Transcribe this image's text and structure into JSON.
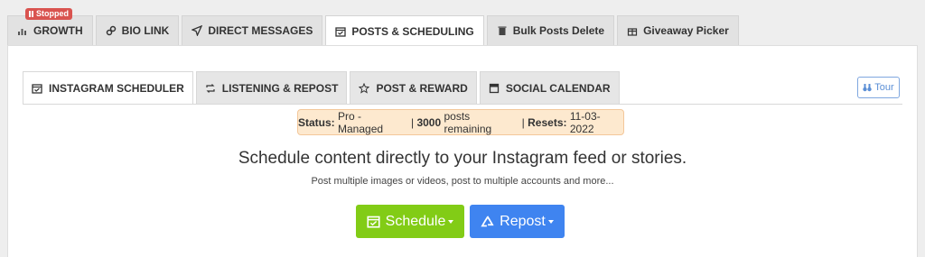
{
  "top_tabs": [
    {
      "label": "GROWTH",
      "icon": "bar-chart-icon",
      "badge": "Stopped"
    },
    {
      "label": "BIO LINK",
      "icon": "link-icon"
    },
    {
      "label": "DIRECT MESSAGES",
      "icon": "paper-plane-icon"
    },
    {
      "label": "POSTS & SCHEDULING",
      "icon": "calendar-check-icon",
      "active": true
    },
    {
      "label": "Bulk Posts Delete",
      "icon": "trash-icon"
    },
    {
      "label": "Giveaway Picker",
      "icon": "gift-icon"
    }
  ],
  "sub_tabs": [
    {
      "label": "INSTAGRAM SCHEDULER",
      "icon": "calendar-check-icon",
      "active": true
    },
    {
      "label": "LISTENING & REPOST",
      "icon": "retweet-icon"
    },
    {
      "label": "POST & REWARD",
      "icon": "star-icon"
    },
    {
      "label": "SOCIAL CALENDAR",
      "icon": "calendar-icon"
    }
  ],
  "tour_label": "Tour",
  "status": {
    "status_label": "Status:",
    "status_value": "Pro - Managed",
    "sep1": "|",
    "posts_count": "3000",
    "posts_text": "posts remaining",
    "sep2": "|",
    "resets_label": "Resets:",
    "resets_value": "11-03-2022"
  },
  "headline": "Schedule content directly to your Instagram feed or stories.",
  "subline": "Post multiple images or videos, post to multiple accounts and more...",
  "buttons": {
    "schedule": "Schedule",
    "repost": "Repost"
  },
  "colors": {
    "schedule_green": "#82cc16",
    "repost_blue": "#3f84f0",
    "stopped_red": "#d9534f",
    "status_bg": "#fde9cf"
  }
}
